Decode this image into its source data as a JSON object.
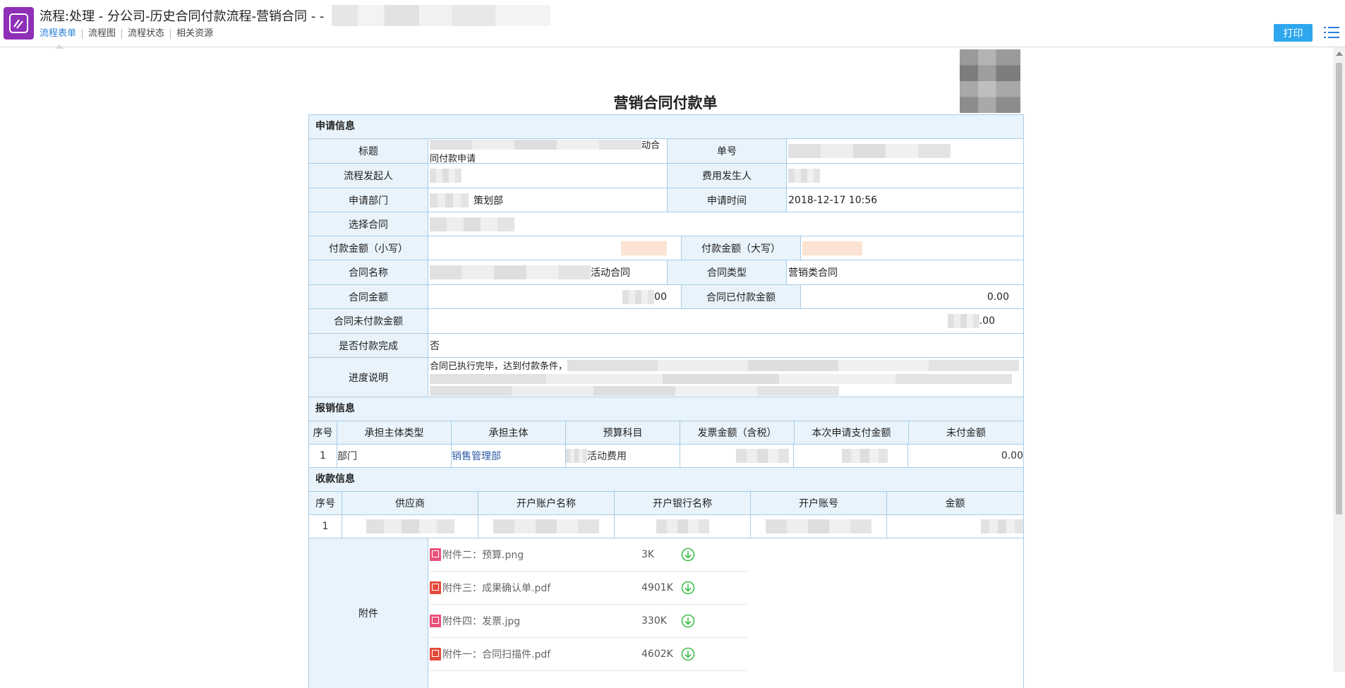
{
  "window": {
    "title": "流程:处理 - 分公司-历史合同付款流程-营销合同 - -"
  },
  "tabs": [
    {
      "label": "流程表单",
      "active": true
    },
    {
      "label": "流程图",
      "active": false
    },
    {
      "label": "流程状态",
      "active": false
    },
    {
      "label": "相关资源",
      "active": false
    }
  ],
  "toolbar": {
    "print_label": "打印",
    "menu_icon": "list-icon"
  },
  "colors": {
    "accent": "#2ea7ee",
    "logo": "#8e2fb8",
    "section_bg": "#e8f3fb",
    "border": "#a9cce6"
  },
  "form": {
    "title": "营销合同付款单",
    "apply_section": "申请信息",
    "fields": {
      "title_label": "标题",
      "title_value_tail": "动合",
      "title_value_line2": "同付款申请",
      "number_label": "单号",
      "initiator_label": "流程发起人",
      "cost_person_label": "费用发生人",
      "dept_label": "申请部门",
      "dept_value": "策划部",
      "apply_time_label": "申请时间",
      "apply_time_value": "2018-12-17 10:56",
      "contract_select_label": "选择合同",
      "pay_small_label": "付款金额（小写）",
      "pay_big_label": "付款金额（大写）",
      "contract_name_label": "合同名称",
      "contract_name_tail": "活动合同",
      "contract_type_label": "合同类型",
      "contract_type_value": "营销类合同",
      "contract_amount_label": "合同金额",
      "contract_amount_tail": "00",
      "contract_paid_label": "合同已付款金额",
      "contract_paid_value": "0.00",
      "contract_unpaid_label": "合同未付款金额",
      "contract_unpaid_tail": ".00",
      "pay_done_label": "是否付款完成",
      "pay_done_value": "否",
      "progress_label": "进度说明",
      "progress_value": "合同已执行完毕，达到付款条件，"
    },
    "reimburse_section": "报销信息",
    "reimburse_headers": [
      "序号",
      "承担主体类型",
      "承担主体",
      "预算科目",
      "发票金额（含税）",
      "本次申请支付金额",
      "未付金额"
    ],
    "reimburse_rows": [
      {
        "no": "1",
        "type": "部门",
        "subject": "销售管理部",
        "budget": "活动费用",
        "unpaid": "0.00"
      }
    ],
    "payee_section": "收款信息",
    "payee_headers": [
      "序号",
      "供应商",
      "开户账户名称",
      "开户银行名称",
      "开户账号",
      "金额"
    ],
    "payee_rows": [
      {
        "no": "1"
      }
    ],
    "attachments_label": "附件",
    "attachments": [
      {
        "name": "附件二：预算.png",
        "size": "3K",
        "icon": "image-file-icon"
      },
      {
        "name": "附件三：成果确认单.pdf",
        "size": "4901K",
        "icon": "pdf-file-icon"
      },
      {
        "name": "附件四：发票.jpg",
        "size": "330K",
        "icon": "image-file-icon"
      },
      {
        "name": "附件一：合同扫描件.pdf",
        "size": "4602K",
        "icon": "pdf-file-icon"
      }
    ]
  }
}
